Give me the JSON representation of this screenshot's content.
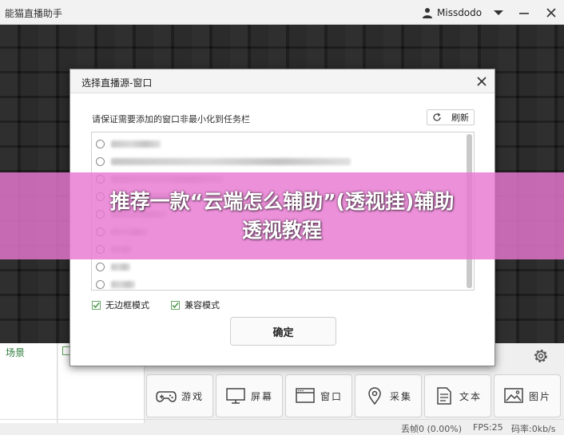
{
  "app": {
    "title": "能猫直播助手",
    "username": "Missdodo"
  },
  "dialog": {
    "title": "选择直播源-窗口",
    "instruction": "请保证需要添加的窗口非最小化到任务栏",
    "refresh_label": "刷新",
    "options": {
      "borderless": "无边框模式",
      "compat": "兼容模式"
    },
    "ok_label": "确定"
  },
  "bottom": {
    "scene_label": "场景",
    "sources": [
      {
        "label": "游戏",
        "icon": "gamepad-icon"
      },
      {
        "label": "屏幕",
        "icon": "monitor-icon"
      },
      {
        "label": "窗口",
        "icon": "window-icon"
      },
      {
        "label": "采集",
        "icon": "location-pin-icon"
      },
      {
        "label": "文本",
        "icon": "text-doc-icon"
      },
      {
        "label": "图片",
        "icon": "image-icon"
      }
    ]
  },
  "status": {
    "dropped": "丢帧0 (0.00%)",
    "fps": "FPS:25",
    "bitrate": "码率:0kb/s"
  },
  "banner": {
    "line1": "推荐一款“云端怎么辅助”(透视挂)辅助",
    "line2": "透视教程"
  },
  "colors": {
    "banner": "#e878d2",
    "accent_green": "#2a7a3a"
  }
}
